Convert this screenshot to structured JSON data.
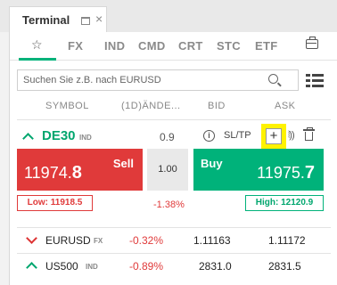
{
  "window": {
    "title": "Terminal",
    "close_glyph": "×"
  },
  "categories": [
    "FX",
    "IND",
    "CMD",
    "CRT",
    "STC",
    "ETF"
  ],
  "search": {
    "placeholder": "Suchen Sie z.B. nach EURUSD"
  },
  "columns": {
    "symbol": "SYMBOL",
    "change": "(1D)ÄNDE...",
    "bid": "BID",
    "ask": "ASK"
  },
  "expanded": {
    "symbol": "DE30",
    "tag": "IND",
    "spread": "0.9",
    "sltp_label": "SL/TP",
    "plus_glyph": "+",
    "sell": {
      "label": "Sell",
      "price_main": "11974.",
      "price_big": "8"
    },
    "volume": "1.00",
    "buy": {
      "label": "Buy",
      "price_main": "11975.",
      "price_big": "7"
    },
    "low": "Low: 11918.5",
    "high": "High: 12120.9",
    "change": "-1.38%"
  },
  "rows": [
    {
      "symbol": "EURUSD",
      "tag": "FX",
      "change": "-0.32%",
      "bid": "1.11163",
      "ask": "1.11172",
      "direction": "down"
    },
    {
      "symbol": "US500",
      "tag": "IND",
      "change": "-0.89%",
      "bid": "2831.0",
      "ask": "2831.5",
      "direction": "up"
    }
  ],
  "colors": {
    "up": "#00b27a",
    "down": "#e03a3a",
    "highlight": "#fff200"
  }
}
